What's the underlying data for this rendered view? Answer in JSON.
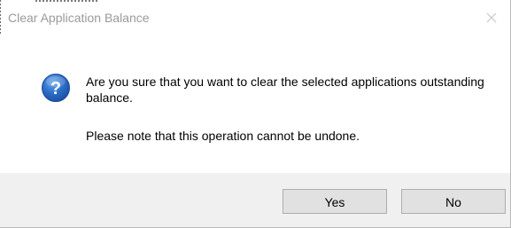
{
  "window": {
    "title": "Clear Application Balance",
    "close_icon": "close-icon"
  },
  "message": {
    "icon": "question-icon",
    "text": "Are you sure that you want to clear the selected applications outstanding balance.",
    "note": "Please note that this operation cannot be undone."
  },
  "buttons": {
    "yes_label": "Yes",
    "no_label": "No"
  },
  "colors": {
    "title_text": "#9a9a9a",
    "footer_background": "#f0f0f0",
    "button_background": "#e1e1e1",
    "button_border": "#adadad",
    "icon_blue": "#1f5fb8"
  }
}
